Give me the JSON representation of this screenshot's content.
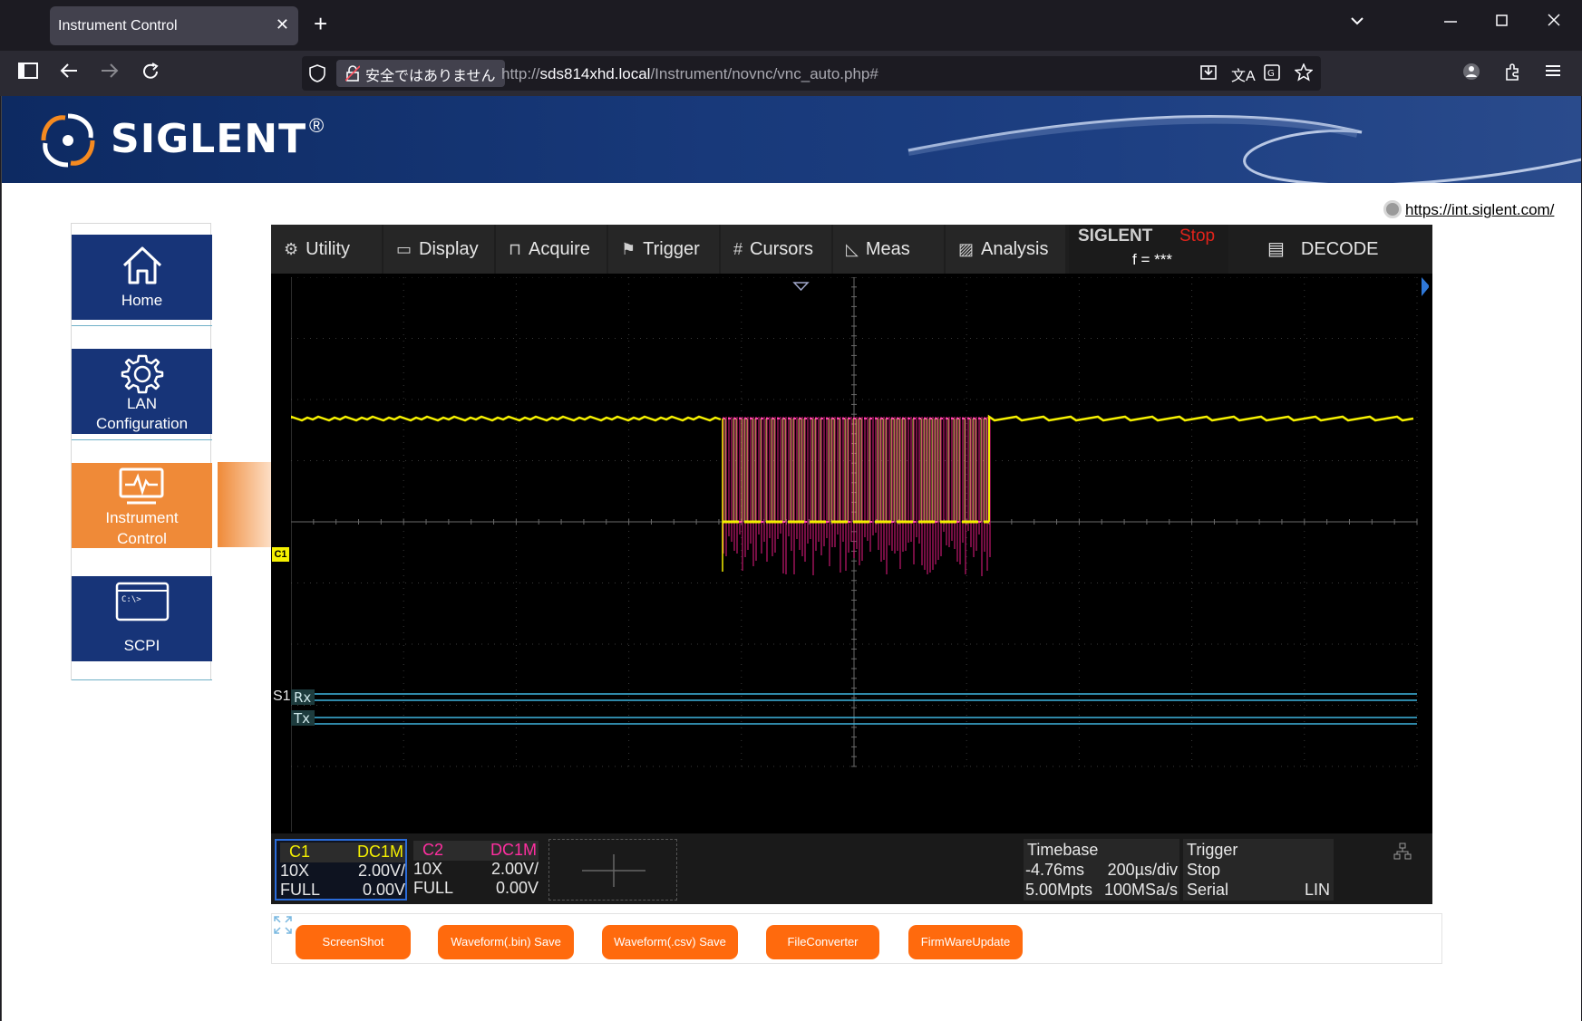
{
  "browser": {
    "tab_title": "Instrument Control",
    "tab_close": "✕",
    "new_tab": "+",
    "security_label": "安全ではありません",
    "url_prefix": "http://",
    "url_host": "sds814xhd.local",
    "url_path": "/Instrument/novnc/vnc_auto.php#"
  },
  "header": {
    "brand": "SIGLENT",
    "registered": "®",
    "site_link": "https://int.siglent.com/"
  },
  "sidebar": {
    "items": [
      {
        "label": "Home"
      },
      {
        "label1": "LAN",
        "label2": "Configuration"
      },
      {
        "label1": "Instrument",
        "label2": "Control"
      },
      {
        "label": "SCPI",
        "prompt": "C:\\>"
      }
    ]
  },
  "scope": {
    "menu": [
      "Utility",
      "Display",
      "Acquire",
      "Trigger",
      "Cursors",
      "Meas",
      "Analysis"
    ],
    "brand": "SIGLENT",
    "run_state": "Stop",
    "freq": "f = ***",
    "decode": "DECODE",
    "channel_marker": "C1",
    "serial_label": "S1",
    "serial_rx": "Rx",
    "serial_tx": "Tx",
    "channels": [
      {
        "name": "C1",
        "coupling": "DC1M",
        "probe": "10X",
        "scale": "2.00V/",
        "bw": "FULL",
        "offset": "0.00V",
        "color": "#f5f000"
      },
      {
        "name": "C2",
        "coupling": "DC1M",
        "probe": "10X",
        "scale": "2.00V/",
        "bw": "FULL",
        "offset": "0.00V",
        "color": "#ff2fa0"
      }
    ],
    "timebase": {
      "title": "Timebase",
      "delay": "-4.76ms",
      "scale": "200µs/div",
      "depth": "5.00Mpts",
      "rate": "100MSa/s"
    },
    "trigger": {
      "title": "Trigger",
      "state": "Stop",
      "type": "Serial",
      "mode": "LIN"
    }
  },
  "buttons": [
    "ScreenShot",
    "Waveform(.bin) Save",
    "Waveform(.csv) Save",
    "FileConverter",
    "FirmWareUpdate"
  ],
  "colors": {
    "accent": "#ff6a0d",
    "nav_blue": "#173478",
    "trace_c1": "#f5f000",
    "trace_c2": "#ff2fa0",
    "serial": "#3fb6e0"
  }
}
